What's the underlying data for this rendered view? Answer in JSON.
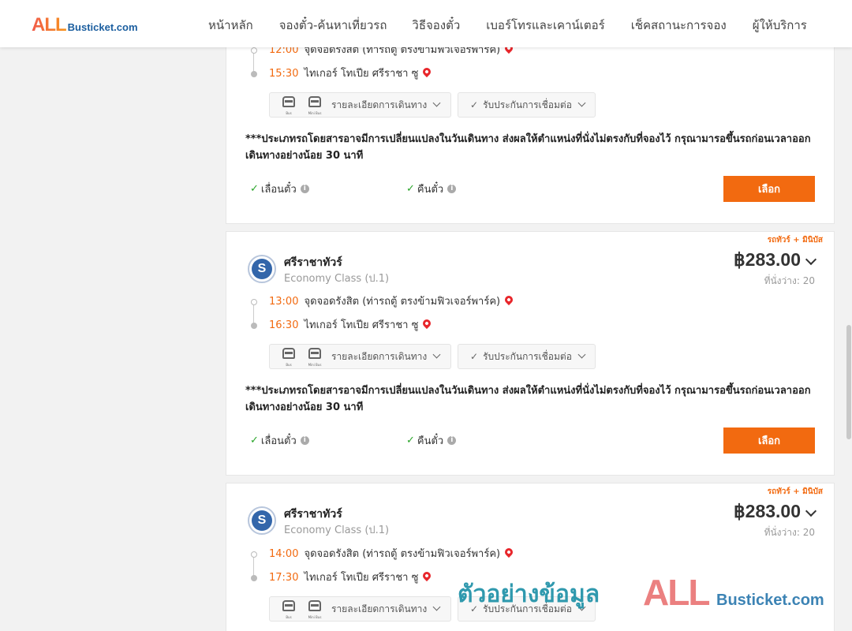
{
  "header": {
    "logo_all": "ALL",
    "logo_rest": "Busticket.com",
    "nav": [
      "หน้าหลัก",
      "จองตั๋ว-ค้นหาเที่ยวรถ",
      "วิธีจองตั๋ว",
      "เบอร์โทรและเคาน์เตอร์",
      "เช็คสถานะการจอง",
      "ผู้ให้บริการ"
    ]
  },
  "common": {
    "details_label": "รายละเอียดการเดินทาง",
    "insurance_label": "รับประกันการเชื่อมต่อ",
    "bus_icon_label": "Bus",
    "minibus_icon_label": "Mini Bus",
    "notice": "***ประเภทรถโดยสารอาจมีการเปลี่ยนแปลงในวันเดินทาง ส่งผลให้ตำแหน่งที่นั่งไม่ตรงกับที่จองไว้ กรุณามารอขึ้นรถก่อนเวลาออกเดินทางอย่างน้อย 30 นาที",
    "reschedule_label": "เลื่อนตั๋ว",
    "refund_label": "คืนตั๋ว",
    "select_label": "เลือก",
    "check_mark": "✓",
    "info_mark": "i"
  },
  "trips": [
    {
      "depart_time": "12:00",
      "depart_place": "จุดจอดรังสิต (ท่ารถตู้ ตรงข้ามฟิวเจอร์พาร์ค)",
      "arrive_time": "15:30",
      "arrive_place": "ไทเกอร์ โทเปีย ศรีราชา ซู"
    },
    {
      "type_tag": "รถทัวร์ + มินิบัส",
      "operator": "ศรีราชาทัวร์",
      "class": "Economy Class (ป.1)",
      "price": "฿283.00",
      "seats": "ที่นั่งว่าง: 20",
      "depart_time": "13:00",
      "depart_place": "จุดจอดรังสิต (ท่ารถตู้ ตรงข้ามฟิวเจอร์พาร์ค)",
      "arrive_time": "16:30",
      "arrive_place": "ไทเกอร์ โทเปีย ศรีราชา ซู"
    },
    {
      "type_tag": "รถทัวร์ + มินิบัส",
      "operator": "ศรีราชาทัวร์",
      "class": "Economy Class (ป.1)",
      "price": "฿283.00",
      "seats": "ที่นั่งว่าง: 20",
      "depart_time": "14:00",
      "depart_place": "จุดจอดรังสิต (ท่ารถตู้ ตรงข้ามฟิวเจอร์พาร์ค)",
      "arrive_time": "17:30",
      "arrive_place": "ไทเกอร์ โทเปีย ศรีราชา ซู"
    }
  ],
  "watermark": {
    "thai": "ตัวอย่างข้อมูล",
    "all": "ALL",
    "rest": "Busticket.com"
  },
  "colors": {
    "accent": "#f26a10",
    "pin": "#e8262b",
    "check": "#2aa52a",
    "brand_blue": "#1b5e9f"
  }
}
